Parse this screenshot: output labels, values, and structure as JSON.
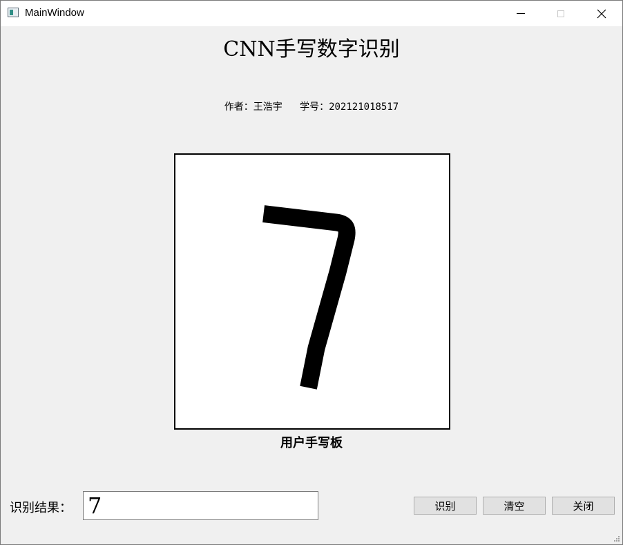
{
  "window": {
    "title": "MainWindow",
    "icons": {
      "app": "app-window-icon",
      "minimize": "minimize-icon",
      "maximize": "maximize-icon",
      "close": "close-icon"
    }
  },
  "header": {
    "title": "CNN手写数字识别",
    "author": "作者：王浩宇   学号：202121018517"
  },
  "canvas": {
    "label": "用户手写板",
    "stroke_color": "#000000",
    "background": "#ffffff"
  },
  "result": {
    "label": "识别结果：",
    "value": "7"
  },
  "buttons": {
    "recognize": "识别",
    "clear": "清空",
    "close": "关闭"
  }
}
